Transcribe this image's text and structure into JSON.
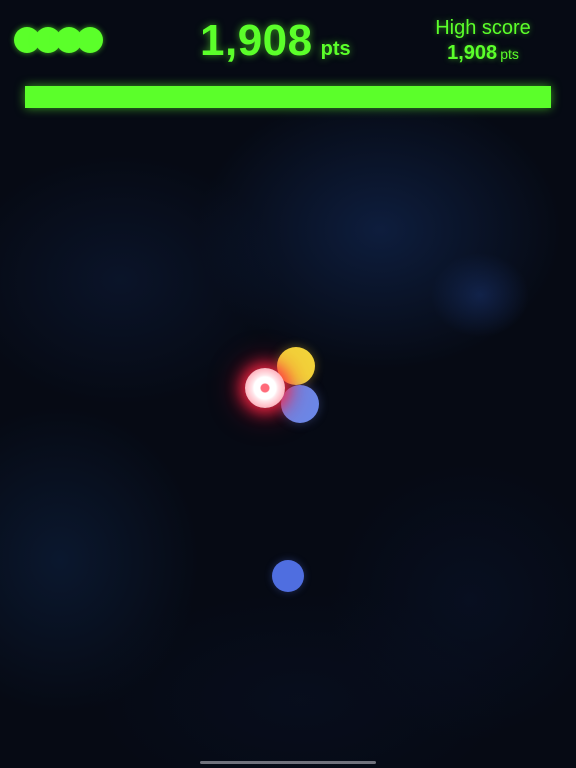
{
  "hud": {
    "lives": 4,
    "score": {
      "value": "1,908",
      "unit": "pts"
    },
    "high_score": {
      "label": "High score",
      "value": "1,908",
      "unit": "pts"
    },
    "progress": 1.0
  },
  "colors": {
    "hud_green": "#5bff2a",
    "background": "#060a14",
    "player_glow": "#ff2846",
    "orb_yellow": "#f2d43a",
    "orb_light_blue": "#6b88e8",
    "orb_blue": "#4f6ee0"
  },
  "orbs": [
    {
      "kind": "player",
      "color": "white-red-glow"
    },
    {
      "kind": "target",
      "color": "yellow"
    },
    {
      "kind": "target",
      "color": "light-blue"
    },
    {
      "kind": "target",
      "color": "blue"
    }
  ]
}
